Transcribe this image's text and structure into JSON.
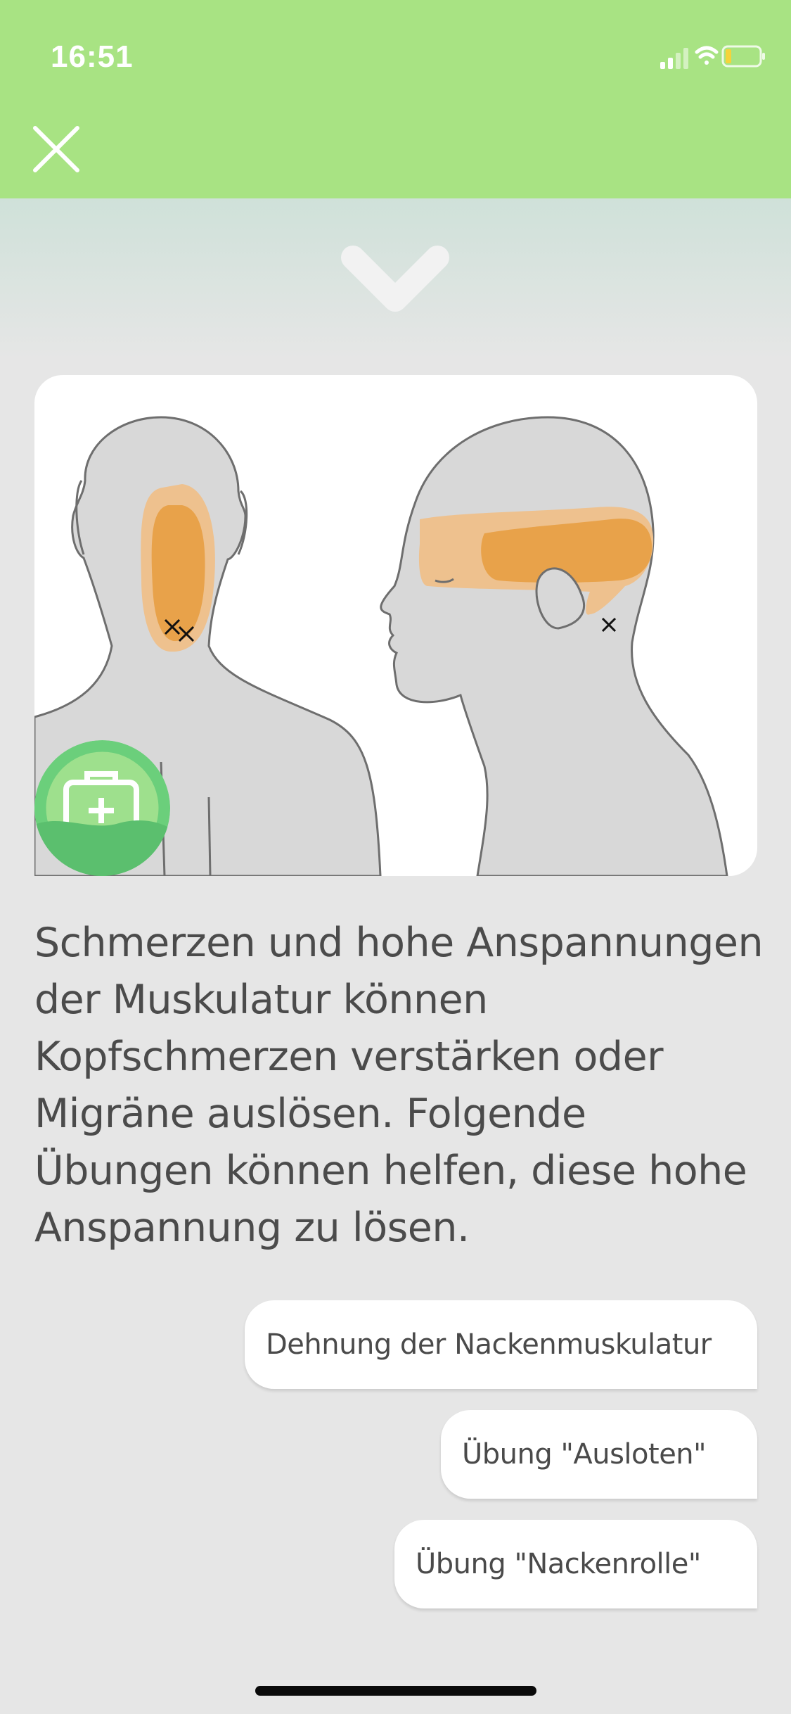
{
  "status_bar": {
    "time": "16:51"
  },
  "header": {
    "close_icon": "close-icon",
    "collapse_icon": "chevron-down-icon"
  },
  "illustration": {
    "description_icons": [
      "head-back-view",
      "head-side-view"
    ],
    "pain_color": "#e8a24a",
    "pain_light_color": "#eec18e",
    "badge_icon": "first-aid-kit-icon"
  },
  "message": {
    "text": "Schmerzen und hohe Anspannungen der Muskulatur können Kopfschmerzen verstärken oder Migräne auslösen. Folgende Übungen können helfen, diese hohe Anspannung zu lösen."
  },
  "replies": [
    {
      "label": "Dehnung der Nackenmuskulatur"
    },
    {
      "label": "Übung \"Ausloten\""
    },
    {
      "label": "Übung \"Nackenrolle\""
    }
  ],
  "colors": {
    "header": "#a8e383",
    "background": "#e6e6e6",
    "text": "#4b4b4b"
  }
}
